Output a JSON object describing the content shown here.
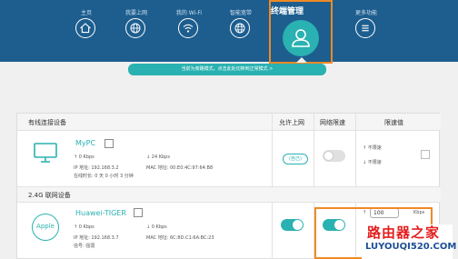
{
  "nav": {
    "items": [
      {
        "label": "主页",
        "icon": "home-icon"
      },
      {
        "label": "我要上网",
        "icon": "globe-icon"
      },
      {
        "label": "我的 Wi-Fi",
        "icon": "wifi-icon"
      },
      {
        "label": "智能宽带",
        "icon": "globe-grid-icon"
      },
      {
        "label": "终端管理",
        "icon": "user-icon"
      },
      {
        "label": "更多功能",
        "icon": "menu-icon"
      }
    ]
  },
  "banner": "当前为旁路模式，点击此处切换到正常模式 >",
  "table": {
    "headers": {
      "wired": "有线连接设备",
      "allow_internet": "允许上网",
      "net_limit": "网络限速",
      "limit_value": "限速值"
    },
    "wired_device": {
      "name": "MyPC",
      "up_rate": "↑ 0 Kbps",
      "down_rate": "↓ 24 Kbps",
      "ip": "IP 地址: 192.168.3.2",
      "mac": "MAC 地址: 00:E0:4C:97:64:B8",
      "duration": "在线时长: 0 天 0 小时 3 分钟",
      "self_tag": "(自己)",
      "up_limit": "↑ 不限速",
      "down_limit": "↓ 不限速"
    },
    "wifi_section": "2.4G 联网设备",
    "wifi_device": {
      "icon_text": "Apple",
      "name": "Huawei-TIGER",
      "up_rate": "↑ 0 Kbps",
      "down_rate": "↓ 0 Kbps",
      "ip": "IP 地址: 192.168.3.7",
      "mac": "MAC 地址: 6C:8D:C1:6A:BC:23",
      "signal": "信号: 强弱",
      "up_limit_value": "100",
      "unit": "Kbps",
      "down_arrow": "↓"
    }
  },
  "watermark": {
    "cn": "路由器之家",
    "en": "LUYOUQI520.COM"
  },
  "colors": {
    "nav_bg": "#1d5e8f",
    "accent": "#2ab1b1",
    "highlight": "#f08a24"
  }
}
